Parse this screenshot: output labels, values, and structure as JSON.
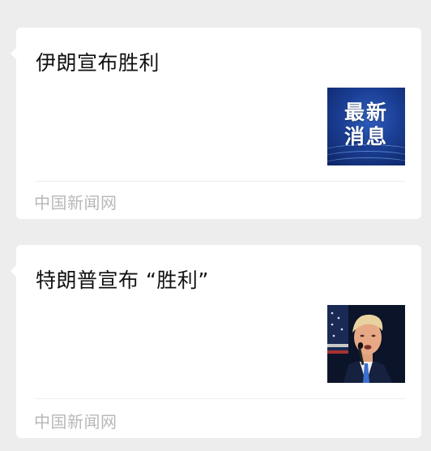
{
  "feed": {
    "articles": [
      {
        "headline": "伊朗宣布胜利",
        "thumbnail": {
          "kind": "breaking-news-graphic",
          "text_line1": "最新",
          "text_line2": "消息",
          "background_color": "#1b3f95"
        },
        "source": "中国新闻网"
      },
      {
        "headline": "特朗普宣布 “胜利”",
        "thumbnail": {
          "kind": "photo",
          "subject": "man-speaking-at-microphone"
        },
        "source": "中国新闻网"
      }
    ]
  },
  "colors": {
    "page_background": "#ededed",
    "card_background": "#ffffff",
    "headline_text": "#111111",
    "source_text": "#b8b8b8"
  }
}
